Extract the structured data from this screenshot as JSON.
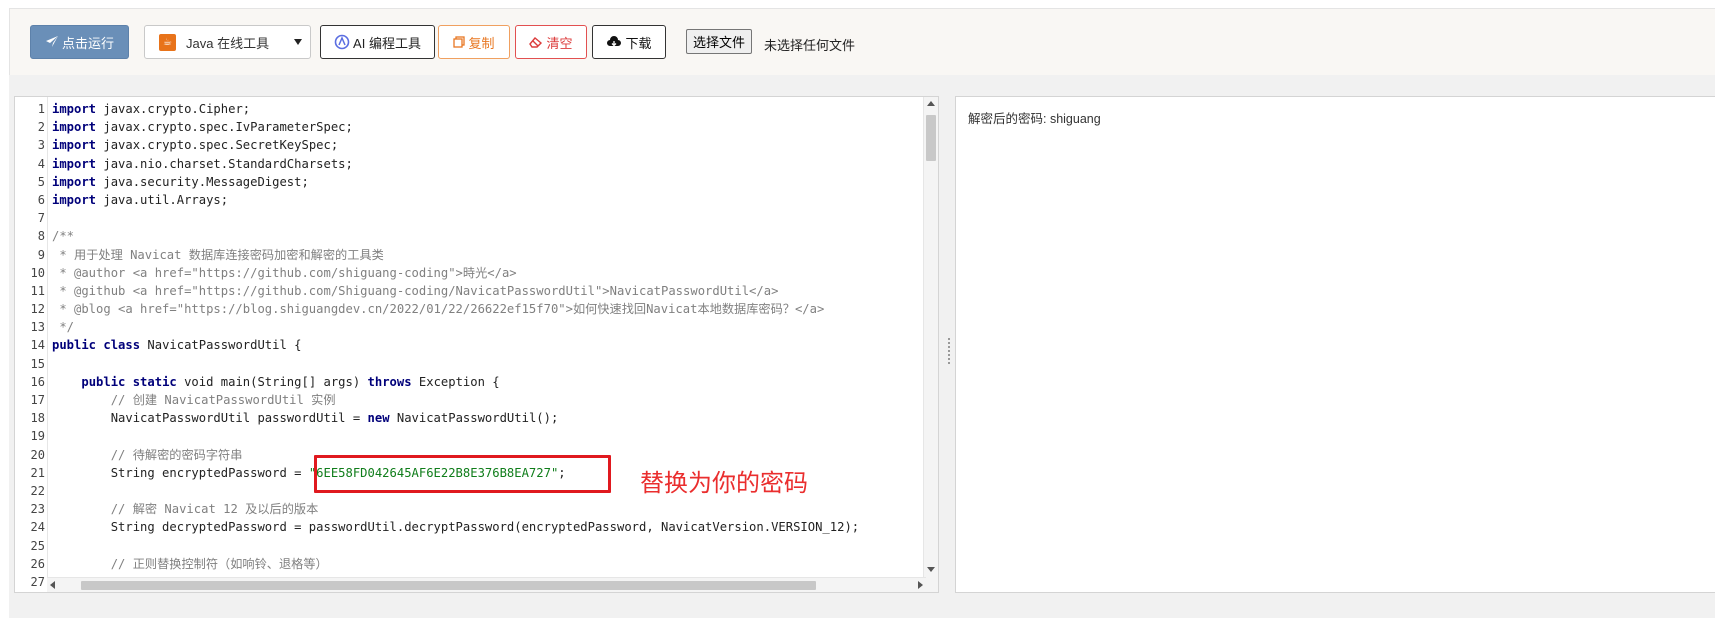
{
  "toolbar": {
    "run_label": "点击运行",
    "language_select": "Java 在线工具",
    "ai_label": "AI 编程工具",
    "copy_label": "复制",
    "clear_label": "清空",
    "download_label": "下载",
    "file_button": "选择文件",
    "file_status": "未选择任何文件"
  },
  "editor": {
    "lines": [
      {
        "n": "1",
        "parts": [
          {
            "t": "kw",
            "v": "import"
          },
          {
            "t": "p",
            "v": " javax.crypto.Cipher;"
          }
        ]
      },
      {
        "n": "2",
        "parts": [
          {
            "t": "kw",
            "v": "import"
          },
          {
            "t": "p",
            "v": " javax.crypto.spec.IvParameterSpec;"
          }
        ]
      },
      {
        "n": "3",
        "parts": [
          {
            "t": "kw",
            "v": "import"
          },
          {
            "t": "p",
            "v": " javax.crypto.spec.SecretKeySpec;"
          }
        ]
      },
      {
        "n": "4",
        "parts": [
          {
            "t": "kw",
            "v": "import"
          },
          {
            "t": "p",
            "v": " java.nio.charset.StandardCharsets;"
          }
        ]
      },
      {
        "n": "5",
        "parts": [
          {
            "t": "kw",
            "v": "import"
          },
          {
            "t": "p",
            "v": " java.security.MessageDigest;"
          }
        ]
      },
      {
        "n": "6",
        "parts": [
          {
            "t": "kw",
            "v": "import"
          },
          {
            "t": "p",
            "v": " java.util.Arrays;"
          }
        ]
      },
      {
        "n": "7",
        "parts": []
      },
      {
        "n": "8",
        "parts": [
          {
            "t": "cm",
            "v": "/**"
          }
        ]
      },
      {
        "n": "9",
        "parts": [
          {
            "t": "cm",
            "v": " * 用于处理 Navicat 数据库连接密码加密和解密的工具类"
          }
        ]
      },
      {
        "n": "10",
        "parts": [
          {
            "t": "cm",
            "v": " * @author <a href=\"https://github.com/shiguang-coding\">時光</a>"
          }
        ]
      },
      {
        "n": "11",
        "parts": [
          {
            "t": "cm",
            "v": " * @github <a href=\"https://github.com/Shiguang-coding/NavicatPasswordUtil\">NavicatPasswordUtil</a>"
          }
        ]
      },
      {
        "n": "12",
        "parts": [
          {
            "t": "cm",
            "v": " * @blog <a href=\"https://blog.shiguangdev.cn/2022/01/22/26622ef15f70\">如何快速找回Navicat本地数据库密码？</a>"
          }
        ]
      },
      {
        "n": "13",
        "parts": [
          {
            "t": "cm",
            "v": " */"
          }
        ]
      },
      {
        "n": "14",
        "parts": [
          {
            "t": "kw",
            "v": "public class"
          },
          {
            "t": "p",
            "v": " NavicatPasswordUtil {"
          }
        ]
      },
      {
        "n": "15",
        "parts": []
      },
      {
        "n": "16",
        "parts": [
          {
            "t": "p",
            "v": "    "
          },
          {
            "t": "kw",
            "v": "public static"
          },
          {
            "t": "p",
            "v": " void main(String[] args) "
          },
          {
            "t": "kw",
            "v": "throws"
          },
          {
            "t": "p",
            "v": " Exception {"
          }
        ]
      },
      {
        "n": "17",
        "parts": [
          {
            "t": "cm",
            "v": "        // 创建 NavicatPasswordUtil 实例"
          }
        ]
      },
      {
        "n": "18",
        "parts": [
          {
            "t": "p",
            "v": "        NavicatPasswordUtil passwordUtil = "
          },
          {
            "t": "kw",
            "v": "new"
          },
          {
            "t": "p",
            "v": " NavicatPasswordUtil();"
          }
        ]
      },
      {
        "n": "19",
        "parts": []
      },
      {
        "n": "20",
        "parts": [
          {
            "t": "cm",
            "v": "        // 待解密的密码字符串"
          }
        ]
      },
      {
        "n": "21",
        "parts": [
          {
            "t": "p",
            "v": "        String encryptedPassword = "
          },
          {
            "t": "str",
            "v": "\"6EE58FD042645AF6E22B8E376B8EA727\""
          },
          {
            "t": "p",
            "v": ";"
          }
        ]
      },
      {
        "n": "22",
        "parts": []
      },
      {
        "n": "23",
        "parts": [
          {
            "t": "cm",
            "v": "        // 解密 Navicat 12 及以后的版本"
          }
        ]
      },
      {
        "n": "24",
        "parts": [
          {
            "t": "p",
            "v": "        String decryptedPassword = passwordUtil.decryptPassword(encryptedPassword, NavicatVersion.VERSION_12);"
          }
        ]
      },
      {
        "n": "25",
        "parts": []
      },
      {
        "n": "26",
        "parts": [
          {
            "t": "cm",
            "v": "        // 正则替换控制符（如响铃、退格等）"
          }
        ]
      },
      {
        "n": "27",
        "parts": []
      }
    ]
  },
  "output": {
    "text": "解密后的密码: shiguang"
  },
  "annotation": {
    "text": "替换为你的密码"
  },
  "colors": {
    "run_button": "#6a8fb8",
    "keyword": "#00007a",
    "comment": "#808080",
    "string": "#0f7d1a",
    "highlight": "#e0191f"
  },
  "icons": [
    "send-icon",
    "java-icon",
    "ai-icon",
    "copy-icon",
    "eraser-icon",
    "cloud-download-icon"
  ]
}
